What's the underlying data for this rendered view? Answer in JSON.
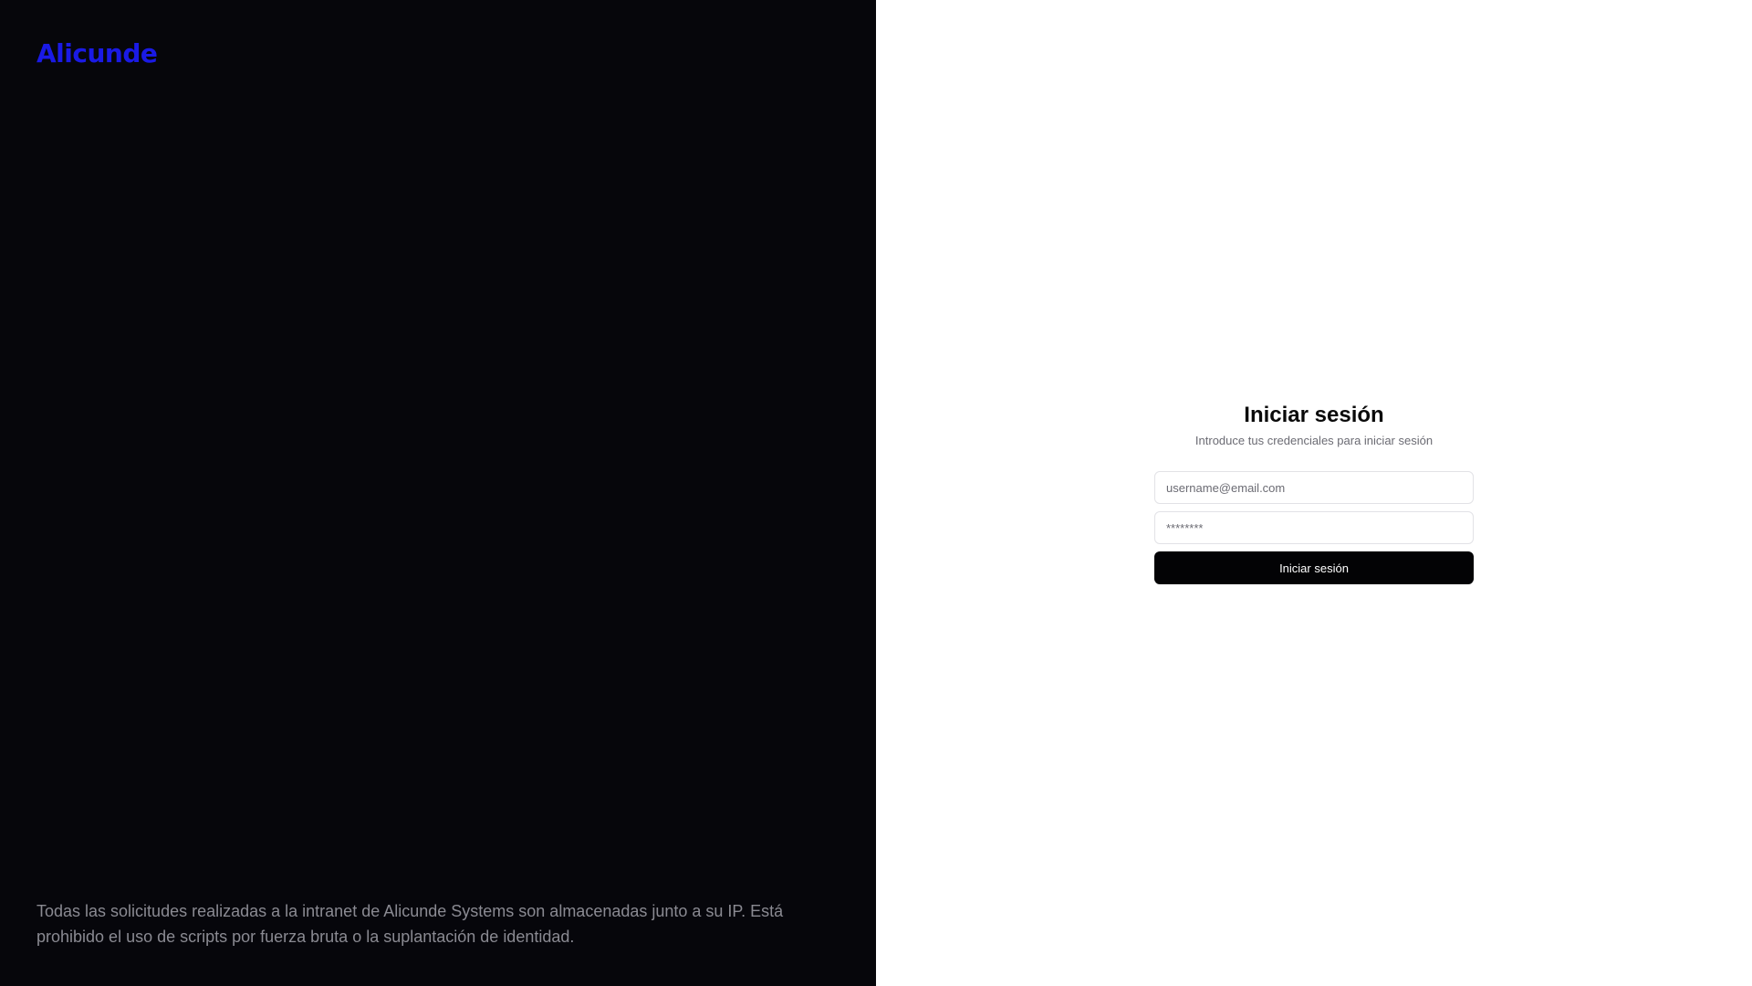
{
  "brand": {
    "name": "Alicunde",
    "color": "#1a1ae6"
  },
  "left_panel": {
    "background": "#06060b",
    "disclaimer": "Todas las solicitudes realizadas a la intranet de Alicunde Systems son almacenadas junto a su IP. Está prohibido el uso de scripts por fuerza bruta o la suplantación de identidad."
  },
  "login": {
    "title": "Iniciar sesión",
    "subtitle": "Introduce tus credenciales para iniciar sesión",
    "email": {
      "placeholder": "username@email.com",
      "value": ""
    },
    "password": {
      "placeholder": "********",
      "value": ""
    },
    "submit_label": "Iniciar sesión"
  }
}
